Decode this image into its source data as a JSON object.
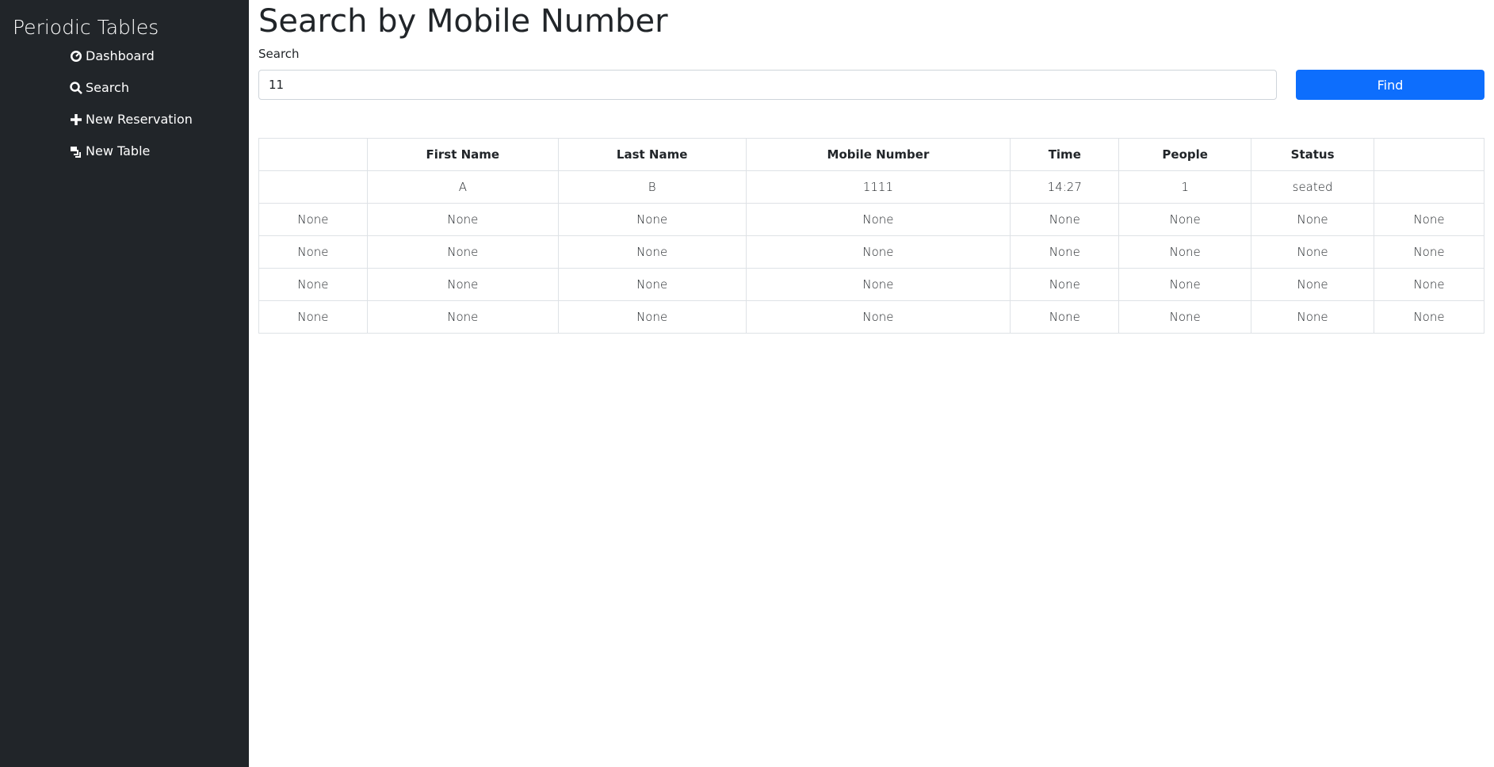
{
  "sidebar": {
    "brand": "Periodic Tables",
    "items": [
      {
        "label": "Dashboard",
        "icon": "dashboard-icon"
      },
      {
        "label": "Search",
        "icon": "search-icon"
      },
      {
        "label": "New Reservation",
        "icon": "plus-icon"
      },
      {
        "label": "New Table",
        "icon": "table-icon"
      }
    ]
  },
  "main": {
    "title": "Search by Mobile Number",
    "search_label": "Search",
    "search_value": "11",
    "find_label": "Find",
    "accent": "#0d6efd",
    "table": {
      "headers": [
        "",
        "First Name",
        "Last Name",
        "Mobile Number",
        "Time",
        "People",
        "Status",
        ""
      ],
      "rows": [
        [
          "",
          "A",
          "B",
          "1111",
          "14:27",
          "1",
          "seated",
          ""
        ],
        [
          "None",
          "None",
          "None",
          "None",
          "None",
          "None",
          "None",
          "None"
        ],
        [
          "None",
          "None",
          "None",
          "None",
          "None",
          "None",
          "None",
          "None"
        ],
        [
          "None",
          "None",
          "None",
          "None",
          "None",
          "None",
          "None",
          "None"
        ],
        [
          "None",
          "None",
          "None",
          "None",
          "None",
          "None",
          "None",
          "None"
        ]
      ]
    }
  }
}
